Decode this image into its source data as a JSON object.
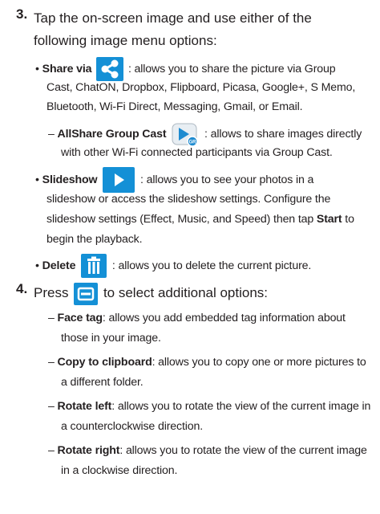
{
  "step3": {
    "num": "3.",
    "line1": "Tap the on-screen image and use either of the",
    "line2": "following image menu options:"
  },
  "share": {
    "bullet": "•",
    "label": "Share via",
    "icon": "share-icon",
    "line1": ": allows you to share the picture via Group",
    "line2": "Cast, ChatON, Dropbox, Flipboard, Picasa, Google+, S Memo,",
    "line3": "Bluetooth, Wi-Fi Direct, Messaging, Gmail, or Email."
  },
  "allshare": {
    "dash": "–",
    "label": "AllShare Group Cast",
    "icon": "allshare-group-cast-icon",
    "line1": ": allows to share images directly",
    "line2": "with other Wi-Fi connected participants via Group Cast."
  },
  "slideshow": {
    "bullet": "•",
    "label": "Slideshow",
    "icon": "play-icon",
    "line1": ": allows you to see your photos in a",
    "line2": "slideshow or access the slideshow settings. Configure the",
    "line3_pre": "slideshow settings (Effect, Music, and Speed) then tap ",
    "line3_bold": "Start",
    "line3_post": " to",
    "line4": "begin the playback."
  },
  "delete": {
    "bullet": "•",
    "label": "Delete",
    "icon": "trash-icon",
    "line1": ": allows you to delete the current picture."
  },
  "step4": {
    "num": "4.",
    "pre": "Press",
    "icon": "menu-icon",
    "post": "to select additional options:"
  },
  "face_tag": {
    "dash": "–",
    "label": "Face tag",
    "line1": ": allows you add embedded tag information about",
    "line2": "those in your image."
  },
  "copy": {
    "dash": "–",
    "label": "Copy to clipboard",
    "line1": ": allows you to copy one or more pictures to",
    "line2": "a different folder."
  },
  "rotate_left": {
    "dash": "–",
    "label": "Rotate left",
    "line1": ": allows you to rotate the view of the current image in",
    "line2": "a counterclockwise direction."
  },
  "rotate_right": {
    "dash": "–",
    "label": "Rotate right",
    "line1": ": allows you to rotate the view of the current image",
    "line2": "in a clockwise direction."
  },
  "colors": {
    "icon_blue": "#1490d6",
    "text": "#231f20"
  }
}
